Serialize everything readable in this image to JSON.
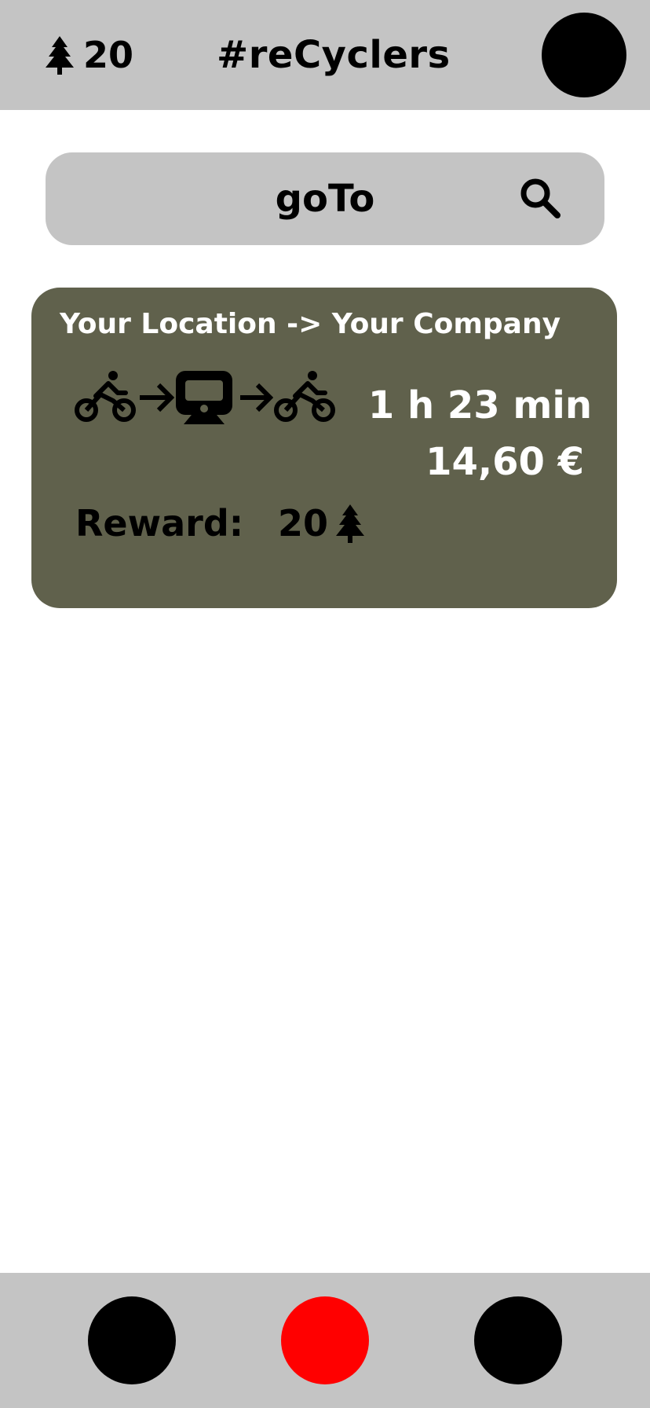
{
  "header": {
    "tree_count": "20",
    "tree_icon": "tree-icon",
    "app_title": "#reCyclers",
    "profile_icon": "profile-avatar"
  },
  "search": {
    "label": "goTo",
    "icon": "search-icon"
  },
  "route": {
    "title": "Your Location -> Your Company",
    "legs": [
      "bike-icon",
      "arrow-right-icon",
      "train-icon",
      "arrow-right-icon",
      "bike-icon"
    ],
    "duration": "1 h 23 min",
    "price": "14,60 €",
    "reward_label": "Reward:",
    "reward_value": "20",
    "reward_icon": "tree-icon"
  },
  "bottom_nav": {
    "buttons": [
      {
        "name": "nav-button-left",
        "color": "#000000"
      },
      {
        "name": "nav-button-center",
        "color": "#ff0000",
        "active": true
      },
      {
        "name": "nav-button-right",
        "color": "#000000"
      }
    ]
  },
  "colors": {
    "bar": "#c4c4c4",
    "card": "#60614c",
    "accent": "#ff0000",
    "text_light": "#ffffff",
    "text_dark": "#000000"
  }
}
